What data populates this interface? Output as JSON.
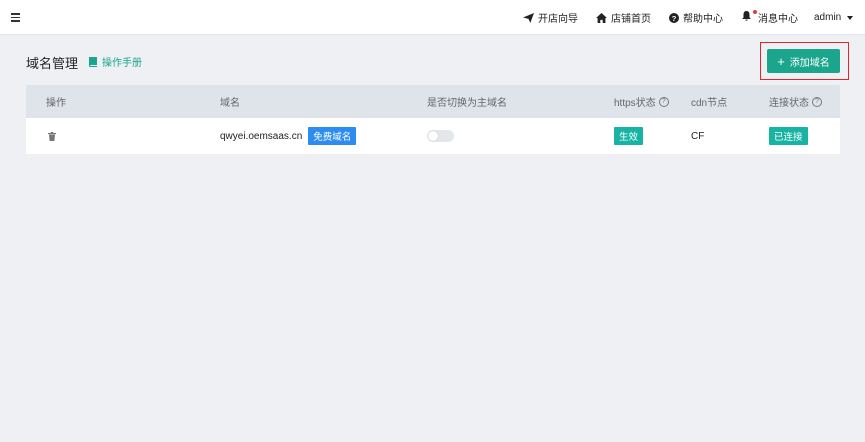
{
  "topbar": {
    "nav": [
      {
        "label": "开店向导",
        "icon": "paper-plane-icon"
      },
      {
        "label": "店铺首页",
        "icon": "home-icon"
      },
      {
        "label": "帮助中心",
        "icon": "question-circle-icon"
      },
      {
        "label": "消息中心",
        "icon": "bell-icon"
      }
    ],
    "user": "admin"
  },
  "page": {
    "title": "域名管理",
    "manual_link": "操作手册",
    "add_button": "添加域名"
  },
  "table": {
    "headers": {
      "action": "操作",
      "domain": "域名",
      "switch_main": "是否切换为主域名",
      "https_status": "https状态",
      "cdn_node": "cdn节点",
      "connection_status": "连接状态"
    },
    "rows": [
      {
        "domain": "qwyei.oemsaas.cn",
        "domain_tag": "免费域名",
        "is_main": false,
        "https_status": "生效",
        "cdn_node": "CF",
        "connection_status": "已连接"
      }
    ]
  },
  "colors": {
    "accent": "#1aa58c",
    "status_tag": "#17b3a3",
    "free_tag": "#2d8cf0",
    "highlight": "#e0262b"
  }
}
